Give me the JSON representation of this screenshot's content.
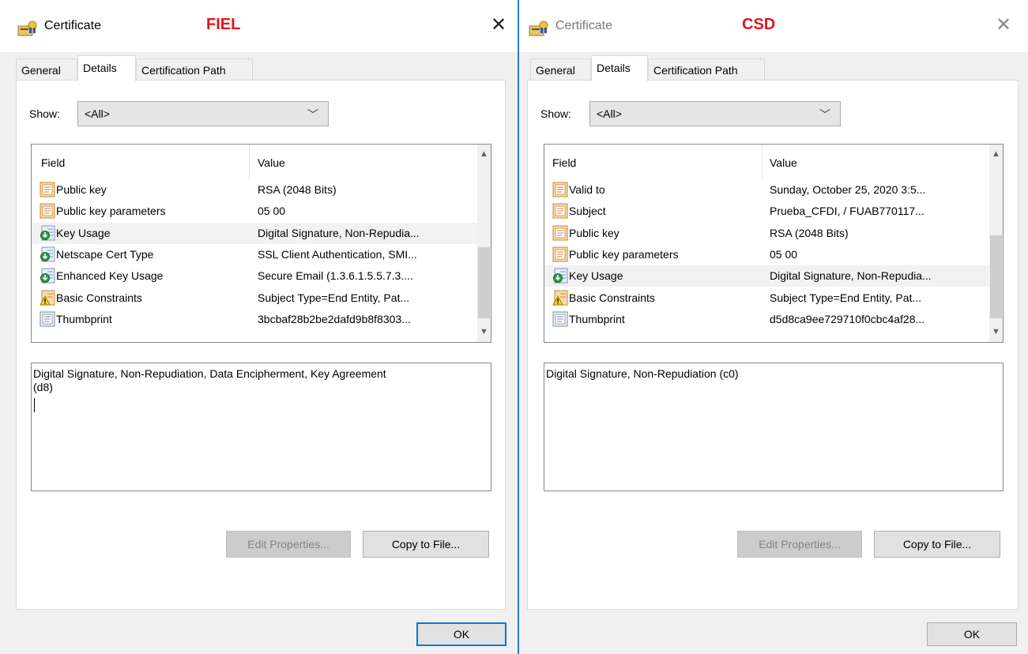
{
  "windows": [
    {
      "title": "Certificate",
      "tag": "FIEL",
      "tag_color": "#e8141c",
      "close": "✕",
      "tabs": [
        "General",
        "Details",
        "Certification Path"
      ],
      "show_label": "Show:",
      "show_value": "<All>",
      "columns": {
        "field": "Field",
        "value": "Value"
      },
      "rows": [
        {
          "icon": "document-icon",
          "field": "Public key",
          "value": "RSA (2048 Bits)"
        },
        {
          "icon": "document-icon",
          "field": "Public key parameters",
          "value": "05 00"
        },
        {
          "icon": "extension-icon",
          "field": "Key Usage",
          "value": "Digital Signature, Non-Repudia..."
        },
        {
          "icon": "extension-icon",
          "field": "Netscape Cert Type",
          "value": "SSL Client Authentication, SMI..."
        },
        {
          "icon": "extension-icon",
          "field": "Enhanced Key Usage",
          "value": "Secure Email (1.3.6.1.5.5.7.3...."
        },
        {
          "icon": "warning-extension-icon",
          "field": "Basic Constraints",
          "value": "Subject Type=End Entity, Pat..."
        },
        {
          "icon": "thumbprint-icon",
          "field": "Thumbprint",
          "value": "3bcbaf28b2be2dafd9b8f8303..."
        }
      ],
      "detail_lines": [
        "Digital Signature, Non-Repudiation, Data Encipherment, Key Agreement",
        "(d8)"
      ],
      "edit_properties": "Edit Properties...",
      "copy_to_file": "Copy to File...",
      "ok": "OK"
    },
    {
      "title": "Certificate",
      "tag": "CSD",
      "tag_color": "#e8141c",
      "close": "✕",
      "tabs": [
        "General",
        "Details",
        "Certification Path"
      ],
      "show_label": "Show:",
      "show_value": "<All>",
      "columns": {
        "field": "Field",
        "value": "Value"
      },
      "rows": [
        {
          "icon": "document-icon",
          "field": "Valid to",
          "value": "Sunday, October 25, 2020 3:5..."
        },
        {
          "icon": "document-icon",
          "field": "Subject",
          "value": "Prueba_CFDI, / FUAB770117..."
        },
        {
          "icon": "document-icon",
          "field": "Public key",
          "value": "RSA (2048 Bits)"
        },
        {
          "icon": "document-icon",
          "field": "Public key parameters",
          "value": "05 00"
        },
        {
          "icon": "extension-icon",
          "field": "Key Usage",
          "value": "Digital Signature, Non-Repudia..."
        },
        {
          "icon": "warning-extension-icon",
          "field": "Basic Constraints",
          "value": "Subject Type=End Entity, Pat..."
        },
        {
          "icon": "thumbprint-icon",
          "field": "Thumbprint",
          "value": "d5d8ca9ee729710f0cbc4af28..."
        }
      ],
      "detail_lines": [
        "Digital Signature, Non-Repudiation (c0)"
      ],
      "edit_properties": "Edit Properties...",
      "copy_to_file": "Copy to File...",
      "ok": "OK"
    }
  ]
}
